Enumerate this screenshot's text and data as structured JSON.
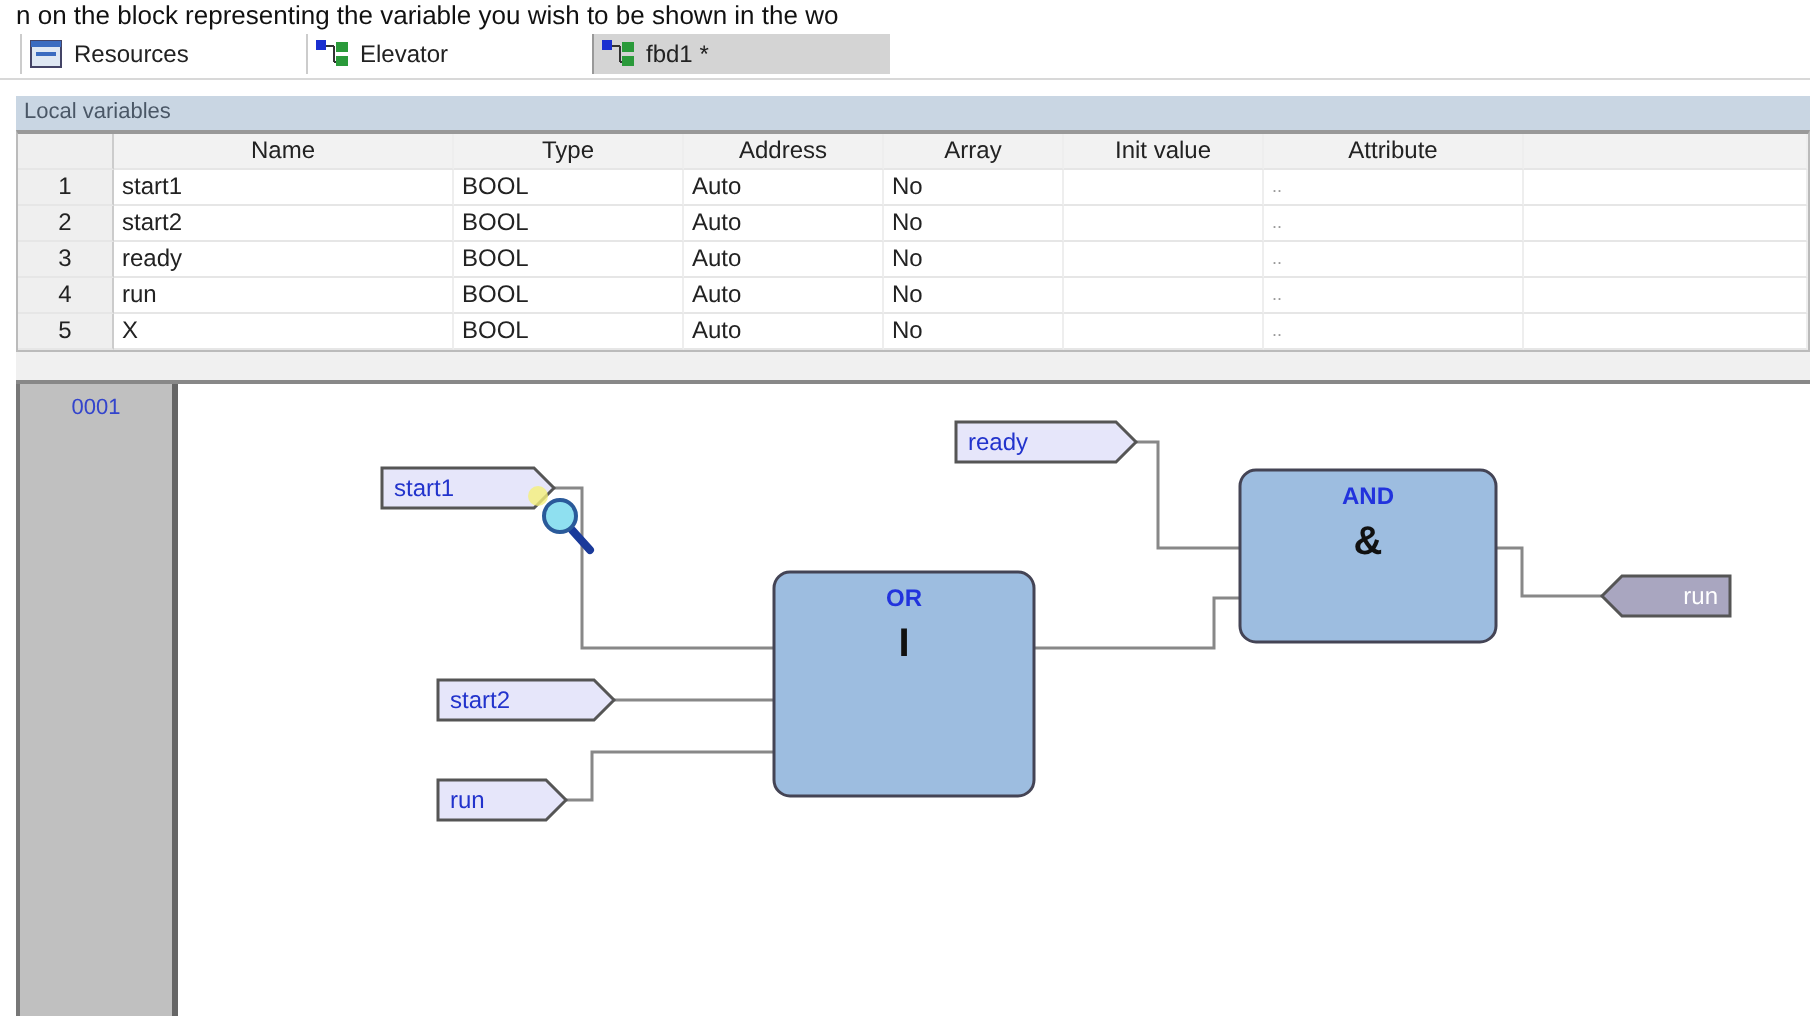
{
  "caption": "n on the block representing the variable you wish to be shown in the wo",
  "tabs": [
    {
      "label": "Resources",
      "kind": "resources",
      "selected": false
    },
    {
      "label": "Elevator",
      "kind": "program",
      "selected": false
    },
    {
      "label": "fbd1 *",
      "kind": "program",
      "selected": true
    }
  ],
  "panel": {
    "title": "Local variables"
  },
  "table": {
    "columns": [
      "Name",
      "Type",
      "Address",
      "Array",
      "Init value",
      "Attribute"
    ],
    "rows": [
      [
        "1",
        "start1",
        "BOOL",
        "Auto",
        "No",
        "",
        ".."
      ],
      [
        "2",
        "start2",
        "BOOL",
        "Auto",
        "No",
        "",
        ".."
      ],
      [
        "3",
        "ready",
        "BOOL",
        "Auto",
        "No",
        "",
        ".."
      ],
      [
        "4",
        "run",
        "BOOL",
        "Auto",
        "No",
        "",
        ".."
      ],
      [
        "5",
        "X",
        "BOOL",
        "Auto",
        "No",
        "",
        ".."
      ]
    ]
  },
  "diagram": {
    "network": "0001",
    "blocks": [
      {
        "name": "OR",
        "symbol": "I"
      },
      {
        "name": "AND",
        "symbol": "&"
      }
    ],
    "variables": [
      {
        "label": "start1",
        "kind": "input"
      },
      {
        "label": "start2",
        "kind": "input"
      },
      {
        "label": "run",
        "kind": "input"
      },
      {
        "label": "ready",
        "kind": "input"
      },
      {
        "label": "run",
        "kind": "output"
      }
    ]
  }
}
